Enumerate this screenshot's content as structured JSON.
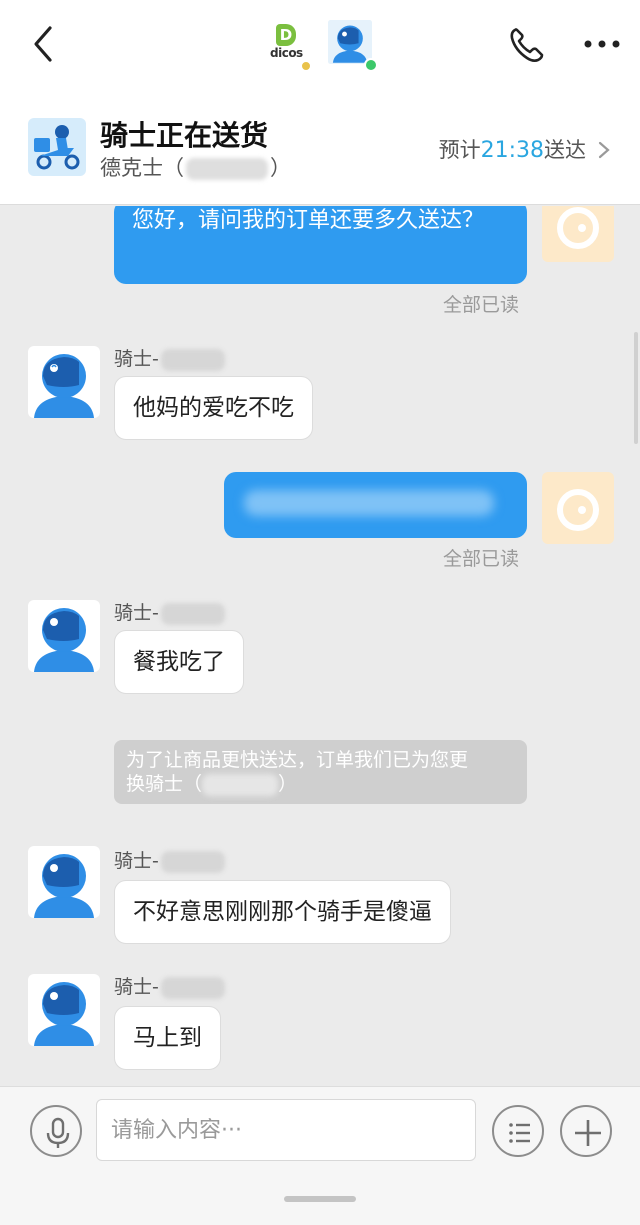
{
  "status": {
    "title": "骑士正在送货",
    "store_name": "德克士（",
    "store_close": "）",
    "eta_prefix": "预计",
    "eta_time": "21:38",
    "eta_suffix": "送达"
  },
  "nav": {
    "brand_text": "dicos",
    "brand_letter": "D"
  },
  "messages": {
    "m1_text": "您好，请问我的订单还要多久送达？",
    "m1_read": "全部已读",
    "r1_sender": "骑士-",
    "r1_text": "他妈的爱吃不吃",
    "m2_read": "全部已读",
    "r2_sender": "骑士-",
    "r2_text": "餐我吃了",
    "system_line1": "为了让商品更快送达，订单我们已为您更",
    "system_line2": "换骑士（",
    "system_close": "）",
    "r3_sender": "骑士-",
    "r3_text": "不好意思刚刚那个骑手是傻逼",
    "r4_sender": "骑士-",
    "r4_text": "马上到"
  },
  "input": {
    "placeholder": "请输入内容···"
  },
  "colors": {
    "accent_blue": "#2f9bf0",
    "eta_blue": "#2aa6e0",
    "online_green": "#3cc86a",
    "avatar_orange": "#fde9c9"
  },
  "icons": {
    "back": "chevron-left-icon",
    "phone": "phone-icon",
    "more": "more-dots-icon",
    "mic": "microphone-icon",
    "menu": "list-menu-icon",
    "plus": "plus-icon"
  }
}
